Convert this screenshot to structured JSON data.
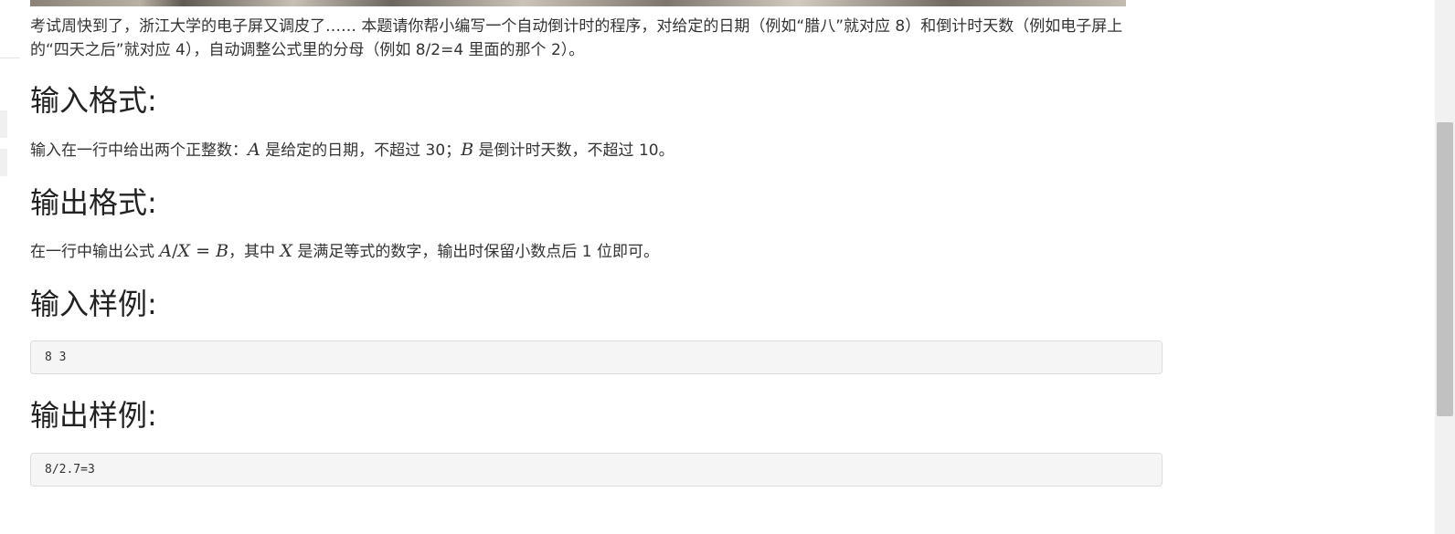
{
  "intro_line1": "考试周快到了，浙江大学的电子屏又调皮了…… 本题请你帮小编写一个自动倒计时的程序，对给定的日期（例如“腊八”就对应 8）和倒计时天数（例如电子屏上",
  "intro_line2": "的“四天之后”就对应 4），自动调整公式里的分母（例如 8/2=4 里面的那个 2）。",
  "input_format": {
    "heading": "输入格式:",
    "text_before_A": "输入在一行中给出两个正整数：",
    "var_A": "A",
    "text_after_A": " 是给定的日期，不超过 30；",
    "var_B": "B",
    "text_after_B": " 是倒计时天数，不超过 10。"
  },
  "output_format": {
    "heading": "输出格式:",
    "text_before_formula": "在一行中输出公式 ",
    "formula_A": "A",
    "formula_slash": "/",
    "formula_X": "X",
    "formula_eq": " = ",
    "formula_B": "B",
    "text_middle": "，其中 ",
    "var_X": "X",
    "text_after": " 是满足等式的数字，输出时保留小数点后 1 位即可。"
  },
  "sample_input": {
    "heading": "输入样例:",
    "code": "8 3"
  },
  "sample_output": {
    "heading": "输出样例:",
    "code": "8/2.7=3"
  }
}
